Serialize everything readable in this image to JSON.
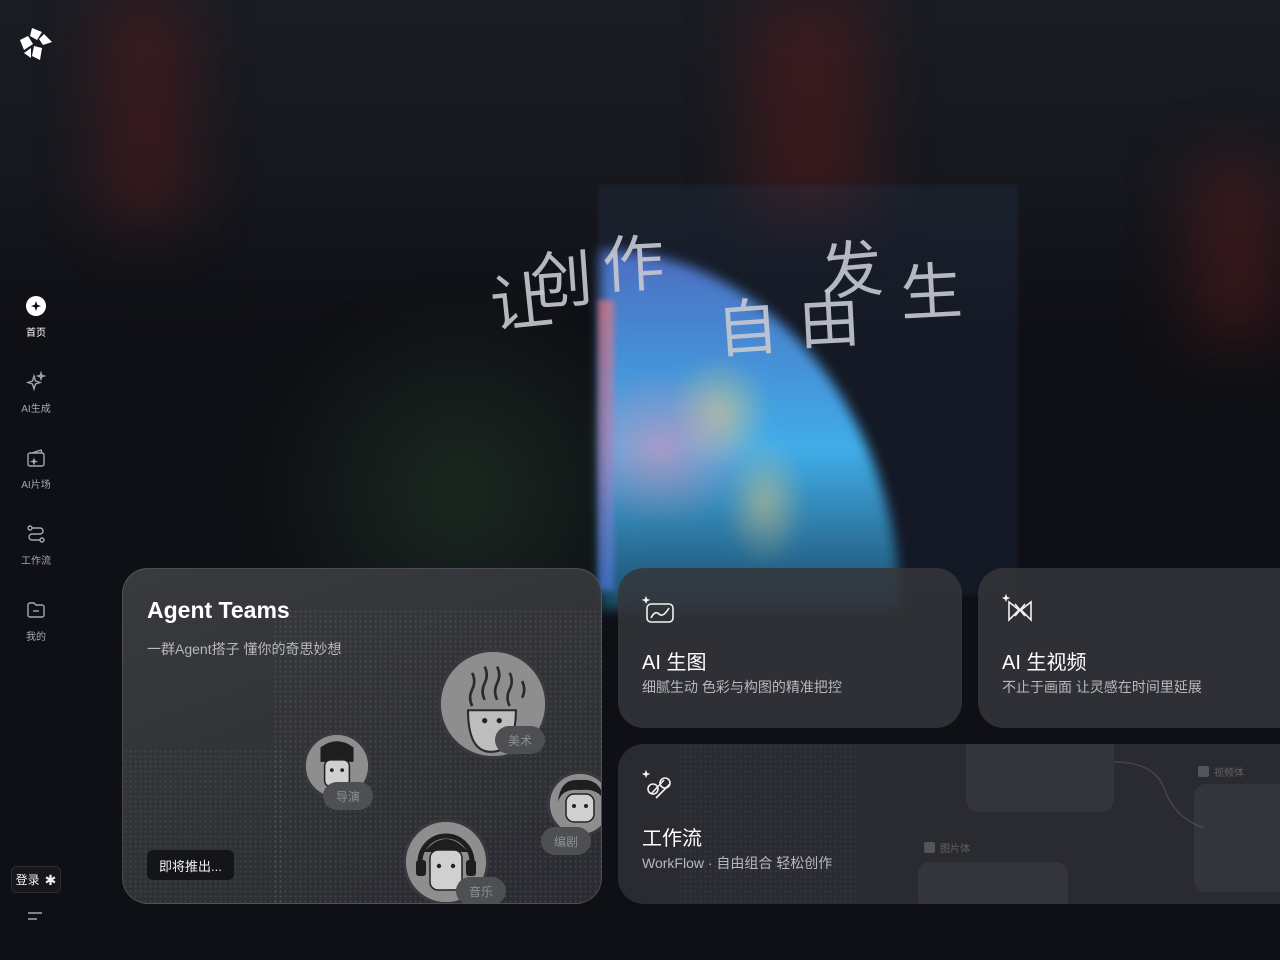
{
  "sidebar": {
    "items": [
      {
        "label": "首页",
        "icon": "home-icon",
        "active": true
      },
      {
        "label": "AI生成",
        "icon": "sparkle-icon",
        "active": false
      },
      {
        "label": "AI片场",
        "icon": "studio-icon",
        "active": false
      },
      {
        "label": "工作流",
        "icon": "workflow-icon",
        "active": false
      },
      {
        "label": "我的",
        "icon": "folder-icon",
        "active": false
      }
    ],
    "login_label": "登录",
    "login_icon": "asterisk-icon",
    "menu_icon": "menu-icon"
  },
  "hero": {
    "chars": [
      "让",
      "创",
      "作",
      "自",
      "由",
      "发",
      "生"
    ]
  },
  "cards": {
    "agent": {
      "title": "Agent Teams",
      "subtitle": "一群Agent搭子 懂你的奇思妙想",
      "cta": "即将推出...",
      "roles": [
        "美术",
        "导演",
        "编剧",
        "音乐"
      ]
    },
    "image": {
      "title": "AI 生图",
      "subtitle": "细腻生动 色彩与构图的精准把控",
      "icon": "ai-image-icon"
    },
    "video": {
      "title": "AI 生视频",
      "subtitle": "不止于画面 让灵感在时间里延展",
      "icon": "ai-video-icon"
    },
    "workflow": {
      "title": "工作流",
      "subtitle": "WorkFlow · 自由组合 轻松创作",
      "icon": "workflow-card-icon",
      "ghost_tags": [
        "图片体",
        "视频体"
      ]
    }
  },
  "colors": {
    "background": "#0f1015",
    "card": "#34353a",
    "text_primary": "#ffffff",
    "text_secondary": "#b7b8be"
  }
}
